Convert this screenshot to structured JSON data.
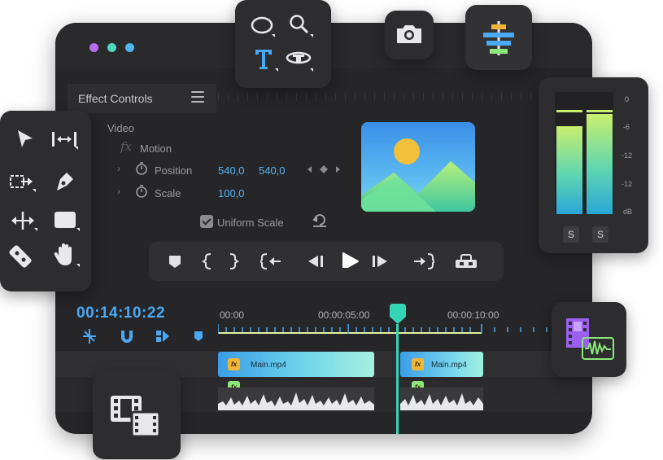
{
  "effect_controls": {
    "title": "Effect Controls",
    "section": "Video",
    "group": "Motion",
    "position_label": "Position",
    "position_x": "540,0",
    "position_y": "540,0",
    "scale_label": "Scale",
    "scale_value": "100,0",
    "uniform_scale_label": "Uniform Scale",
    "uniform_scale_checked": true
  },
  "timeline": {
    "timecode": "00:14:10:22",
    "ruler_labels": [
      "00:00",
      "00:00:05:00",
      "00:00:10:00"
    ],
    "clips": [
      {
        "label": "Main.mp4",
        "badge": "fx"
      },
      {
        "label": "Main.mp4",
        "badge": "fx"
      }
    ],
    "audio_badge": "fx"
  },
  "audio_meter": {
    "scale": [
      "0",
      "-6",
      "-12",
      "-12",
      "dB"
    ],
    "buttons": [
      "S",
      "S"
    ],
    "levels": [
      0.72,
      0.82
    ]
  },
  "colors": {
    "accent_blue": "#4aa9f4",
    "playhead": "#33d7b6",
    "clip_fx": "#f2b53a",
    "audio_fx": "#8ce77b",
    "window_bg": "#262628"
  }
}
